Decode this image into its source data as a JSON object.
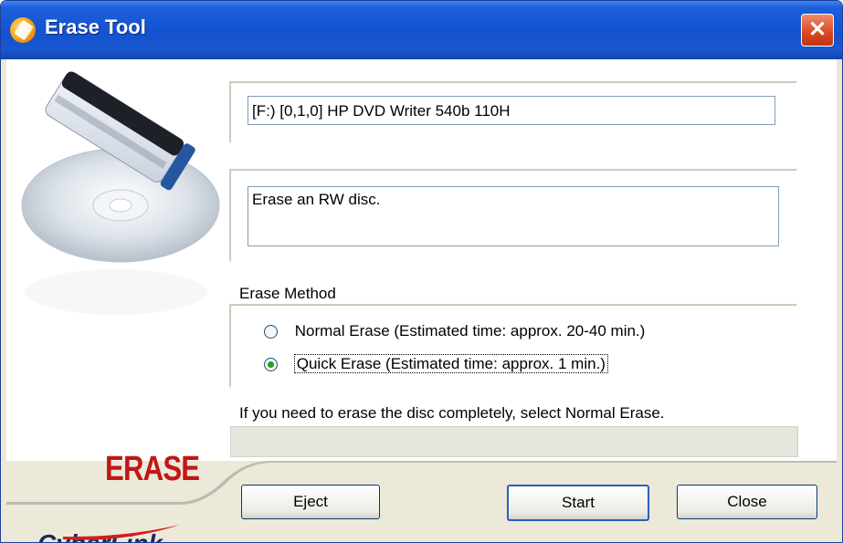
{
  "window": {
    "title": "Erase Tool",
    "close_icon": "close-icon"
  },
  "drive": {
    "value": "[F:) [0,1,0] HP      DVD Writer 540b  110H"
  },
  "description": {
    "value": "Erase an RW disc."
  },
  "erase_method": {
    "label": "Erase Method",
    "options": [
      {
        "label": "Normal Erase (Estimated time: approx. 20-40 min.)",
        "selected": false
      },
      {
        "label": "Quick Erase (Estimated time: approx. 1 min.)",
        "selected": true
      }
    ]
  },
  "hint": "If you need to erase the disc completely, select Normal Erase.",
  "brand": {
    "erase_logo": "ERASE",
    "cyberlink_logo": "CyberLink"
  },
  "buttons": {
    "eject": "Eject",
    "start": "Start",
    "close": "Close"
  },
  "colors": {
    "titlebar": "#1452cf",
    "close": "#d9471f",
    "logo_red": "#c21717"
  }
}
